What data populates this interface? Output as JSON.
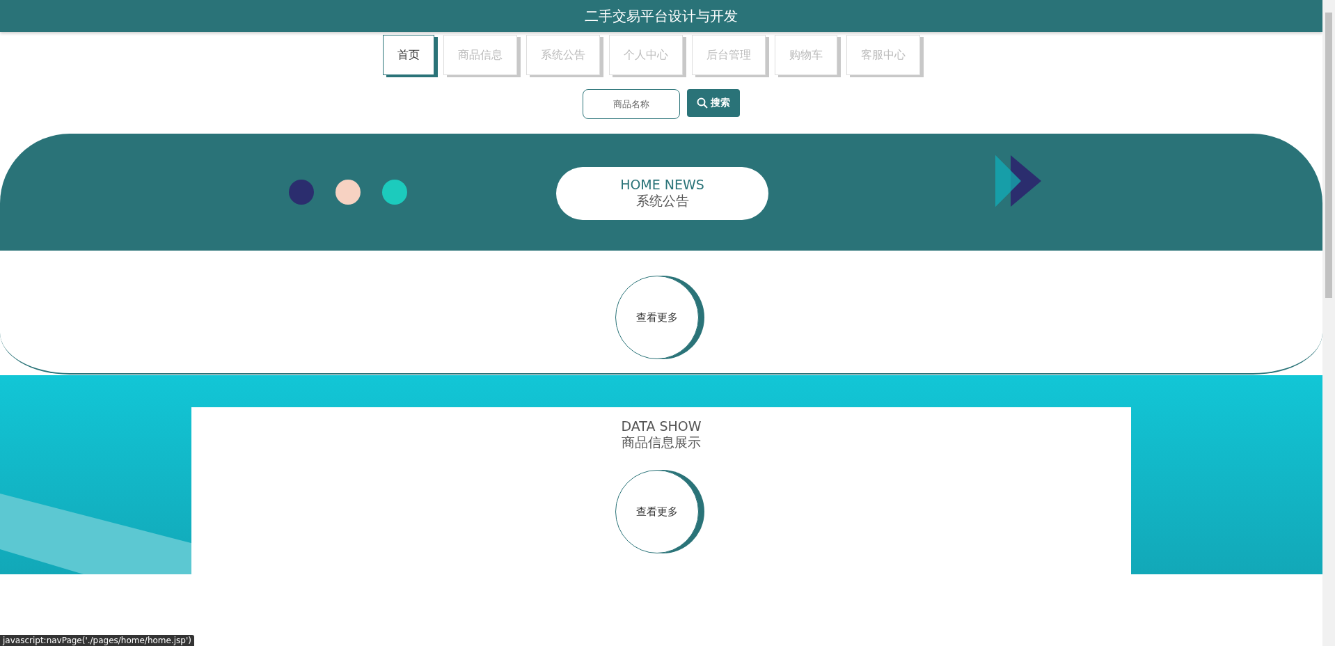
{
  "header": {
    "title": "二手交易平台设计与开发"
  },
  "nav": [
    {
      "label": "首页",
      "selected": true
    },
    {
      "label": "商品信息",
      "selected": false
    },
    {
      "label": "系统公告",
      "selected": false
    },
    {
      "label": "个人中心",
      "selected": false
    },
    {
      "label": "后台管理",
      "selected": false
    },
    {
      "label": "购物车",
      "selected": false
    },
    {
      "label": "客服中心",
      "selected": false
    }
  ],
  "search": {
    "placeholder": "商品名称",
    "button": "搜索"
  },
  "news": {
    "dots": [
      {
        "color": "#2b2d6e"
      },
      {
        "color": "#f7d2c2"
      },
      {
        "color": "#1ccbbd"
      }
    ],
    "title_en": "HOME NEWS",
    "title": "系统公告",
    "more": "查看更多"
  },
  "data_show": {
    "title_en": "DATA SHOW",
    "title": "商品信息展示",
    "more": "查看更多"
  },
  "status_bar": "javascript:navPage('./pages/home/home.jsp')"
}
